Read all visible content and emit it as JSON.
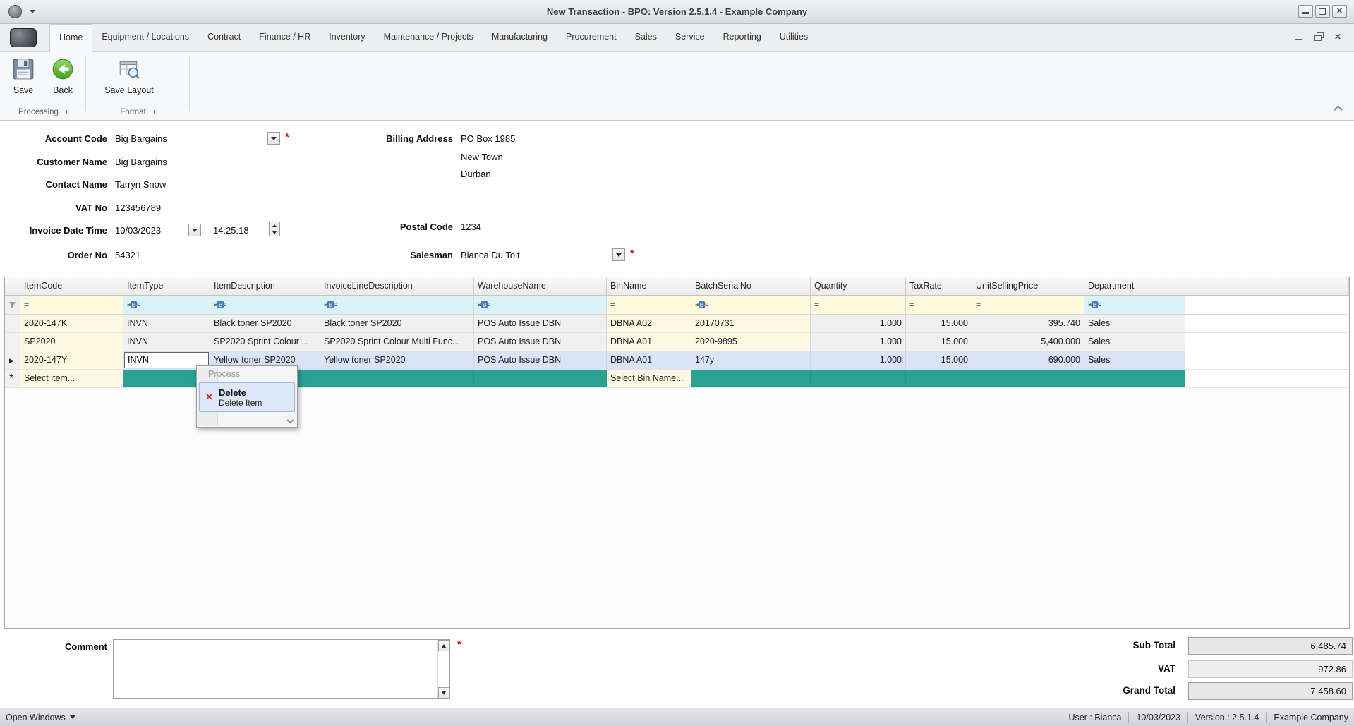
{
  "window": {
    "title": "New Transaction - BPO: Version 2.5.1.4 - Example Company"
  },
  "ribbon": {
    "tabs": [
      "Home",
      "Equipment / Locations",
      "Contract",
      "Finance / HR",
      "Inventory",
      "Maintenance / Projects",
      "Manufacturing",
      "Procurement",
      "Sales",
      "Service",
      "Reporting",
      "Utilities"
    ],
    "selected_tab": "Home",
    "buttons": {
      "save": "Save",
      "back": "Back",
      "save_layout": "Save Layout"
    },
    "groups": {
      "processing": "Processing",
      "format": "Format"
    }
  },
  "form": {
    "account_code": {
      "label": "Account Code",
      "value": "Big Bargains"
    },
    "customer_name": {
      "label": "Customer Name",
      "value": "Big Bargains"
    },
    "contact_name": {
      "label": "Contact Name",
      "value": "Tarryn Snow"
    },
    "vat_no": {
      "label": "VAT No",
      "value": "123456789"
    },
    "invoice_date_time": {
      "label": "Invoice Date Time",
      "date": "10/03/2023",
      "time": "14:25:18"
    },
    "order_no": {
      "label": "Order No",
      "value": "54321"
    },
    "billing_address": {
      "label": "Billing Address",
      "line1": "PO Box 1985",
      "line2": "New Town",
      "line3": "Durban"
    },
    "postal_code": {
      "label": "Postal Code",
      "value": "1234"
    },
    "salesman": {
      "label": "Salesman",
      "value": "Bianca Du Toit"
    }
  },
  "grid": {
    "columns": [
      "ItemCode",
      "ItemType",
      "ItemDescription",
      "InvoiceLineDescription",
      "WarehouseName",
      "BinName",
      "BatchSerialNo",
      "Quantity",
      "TaxRate",
      "UnitSellingPrice",
      "Department"
    ],
    "rows": [
      {
        "item_code": "2020-147K",
        "item_type": "INVN",
        "item_description": "Black toner SP2020",
        "invoice_line_description": "Black toner SP2020",
        "warehouse_name": "POS Auto Issue DBN",
        "bin_name": "DBNA A02",
        "batch_serial_no": "20170731",
        "quantity": "1.000",
        "tax_rate": "15.000",
        "unit_selling_price": "395.740",
        "department": "Sales"
      },
      {
        "item_code": "SP2020",
        "item_type": "INVN",
        "item_description": "SP2020 Sprint Colour ...",
        "invoice_line_description": "SP2020 Sprint Colour Multi Func...",
        "warehouse_name": "POS Auto Issue DBN",
        "bin_name": "DBNA A01",
        "batch_serial_no": "2020-9895",
        "quantity": "1.000",
        "tax_rate": "15.000",
        "unit_selling_price": "5,400.000",
        "department": "Sales"
      },
      {
        "item_code": "2020-147Y",
        "item_type": "INVN",
        "item_description": "Yellow toner SP2020",
        "invoice_line_description": "Yellow toner SP2020",
        "warehouse_name": "POS Auto Issue DBN",
        "bin_name": "DBNA A01",
        "batch_serial_no": "147y",
        "quantity": "1.000",
        "tax_rate": "15.000",
        "unit_selling_price": "690.000",
        "department": "Sales"
      }
    ],
    "new_row": {
      "item_code_placeholder": "Select item...",
      "bin_name_placeholder": "Select Bin Name..."
    }
  },
  "context_menu": {
    "header": "Process",
    "delete_label": "Delete",
    "delete_sublabel": "Delete Item"
  },
  "comment": {
    "label": "Comment",
    "value": ""
  },
  "totals": {
    "sub_total": {
      "label": "Sub Total",
      "value": "6,485.74"
    },
    "vat": {
      "label": "VAT",
      "value": "972.86"
    },
    "grand_total": {
      "label": "Grand Total",
      "value": "7,458.60"
    }
  },
  "status_bar": {
    "open_windows": "Open Windows",
    "user": "User : Bianca",
    "date": "10/03/2023",
    "version": "Version : 2.5.1.4",
    "company": "Example Company"
  }
}
